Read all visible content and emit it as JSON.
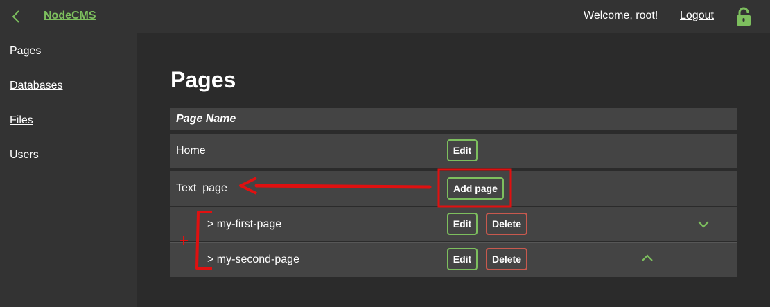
{
  "header": {
    "brand": "NodeCMS",
    "welcome": "Welcome, root!",
    "logout": "Logout"
  },
  "sidebar": {
    "items": [
      {
        "label": "Pages"
      },
      {
        "label": "Databases"
      },
      {
        "label": "Files"
      },
      {
        "label": "Users"
      }
    ]
  },
  "main": {
    "title": "Pages",
    "table": {
      "header": "Page Name",
      "rows": [
        {
          "name": "Home",
          "actions": [
            "Edit"
          ]
        },
        {
          "name": "Text_page",
          "actions": [
            "Add page"
          ]
        },
        {
          "name": "> my-first-page",
          "actions": [
            "Edit",
            "Delete"
          ]
        },
        {
          "name": "> my-second-page",
          "actions": [
            "Edit",
            "Delete"
          ]
        }
      ]
    }
  },
  "colors": {
    "accent": "#7dbf5e",
    "danger": "#c8594e",
    "annotation": "#e01010",
    "bar": "#333333",
    "row": "#444444"
  },
  "icons": [
    "chevron-left-icon",
    "unlock-icon",
    "chevron-down-icon",
    "chevron-up-icon"
  ]
}
